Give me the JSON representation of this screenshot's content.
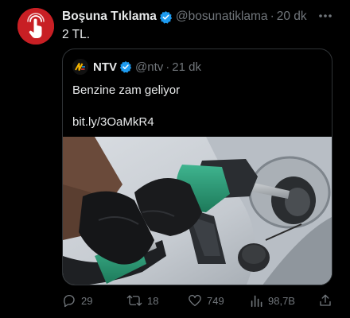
{
  "tweet": {
    "author": {
      "display_name": "Boşuna Tıklama",
      "handle": "@bosunatiklama",
      "time": "20 dk",
      "verified": true,
      "avatar_color": "#c81f24"
    },
    "separator": "·",
    "text": "2 TL.",
    "quoted": {
      "author": {
        "display_name": "NTV",
        "handle": "@ntv",
        "time": "21 dk",
        "verified": true
      },
      "text": "Benzine zam geliyor",
      "link": "bit.ly/3OaMkR4",
      "image_icon": "fuel-pump-photo"
    },
    "actions": {
      "replies": "29",
      "retweets": "18",
      "likes": "749",
      "views": "98,7B"
    }
  },
  "colors": {
    "background": "#000000",
    "text_primary": "#e7e9ea",
    "text_secondary": "#71767b",
    "verified_blue": "#1d9bf0",
    "border": "#2f3336"
  }
}
